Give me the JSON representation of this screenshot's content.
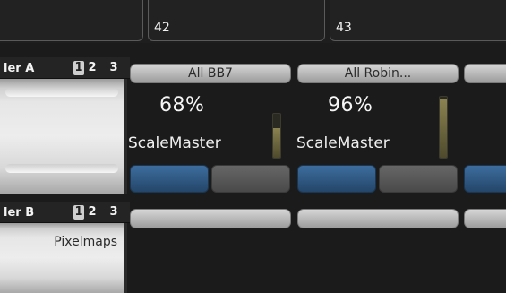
{
  "top_strip": {
    "cells": [
      {
        "number": ""
      },
      {
        "number": "42"
      },
      {
        "number": "43"
      }
    ]
  },
  "bank_a": {
    "title": "ler A",
    "pages": [
      "1",
      "2",
      "3"
    ],
    "active_page": "1",
    "handles": [
      {
        "name": "All BB7",
        "percent": "68%",
        "mode": "ScaleMaster",
        "level": 0.68
      },
      {
        "name": "All Robin...",
        "percent": "96%",
        "mode": "ScaleMaster",
        "level": 0.96
      }
    ]
  },
  "bank_b": {
    "title": "ler B",
    "pages": [
      "1",
      "2",
      "3"
    ],
    "active_page": "1",
    "label": "Pixelmaps"
  },
  "colors": {
    "background": "#1b1b1b",
    "button_blue": "#2f5a85",
    "button_gray": "#555555",
    "meter_fill": "#7a7347"
  }
}
